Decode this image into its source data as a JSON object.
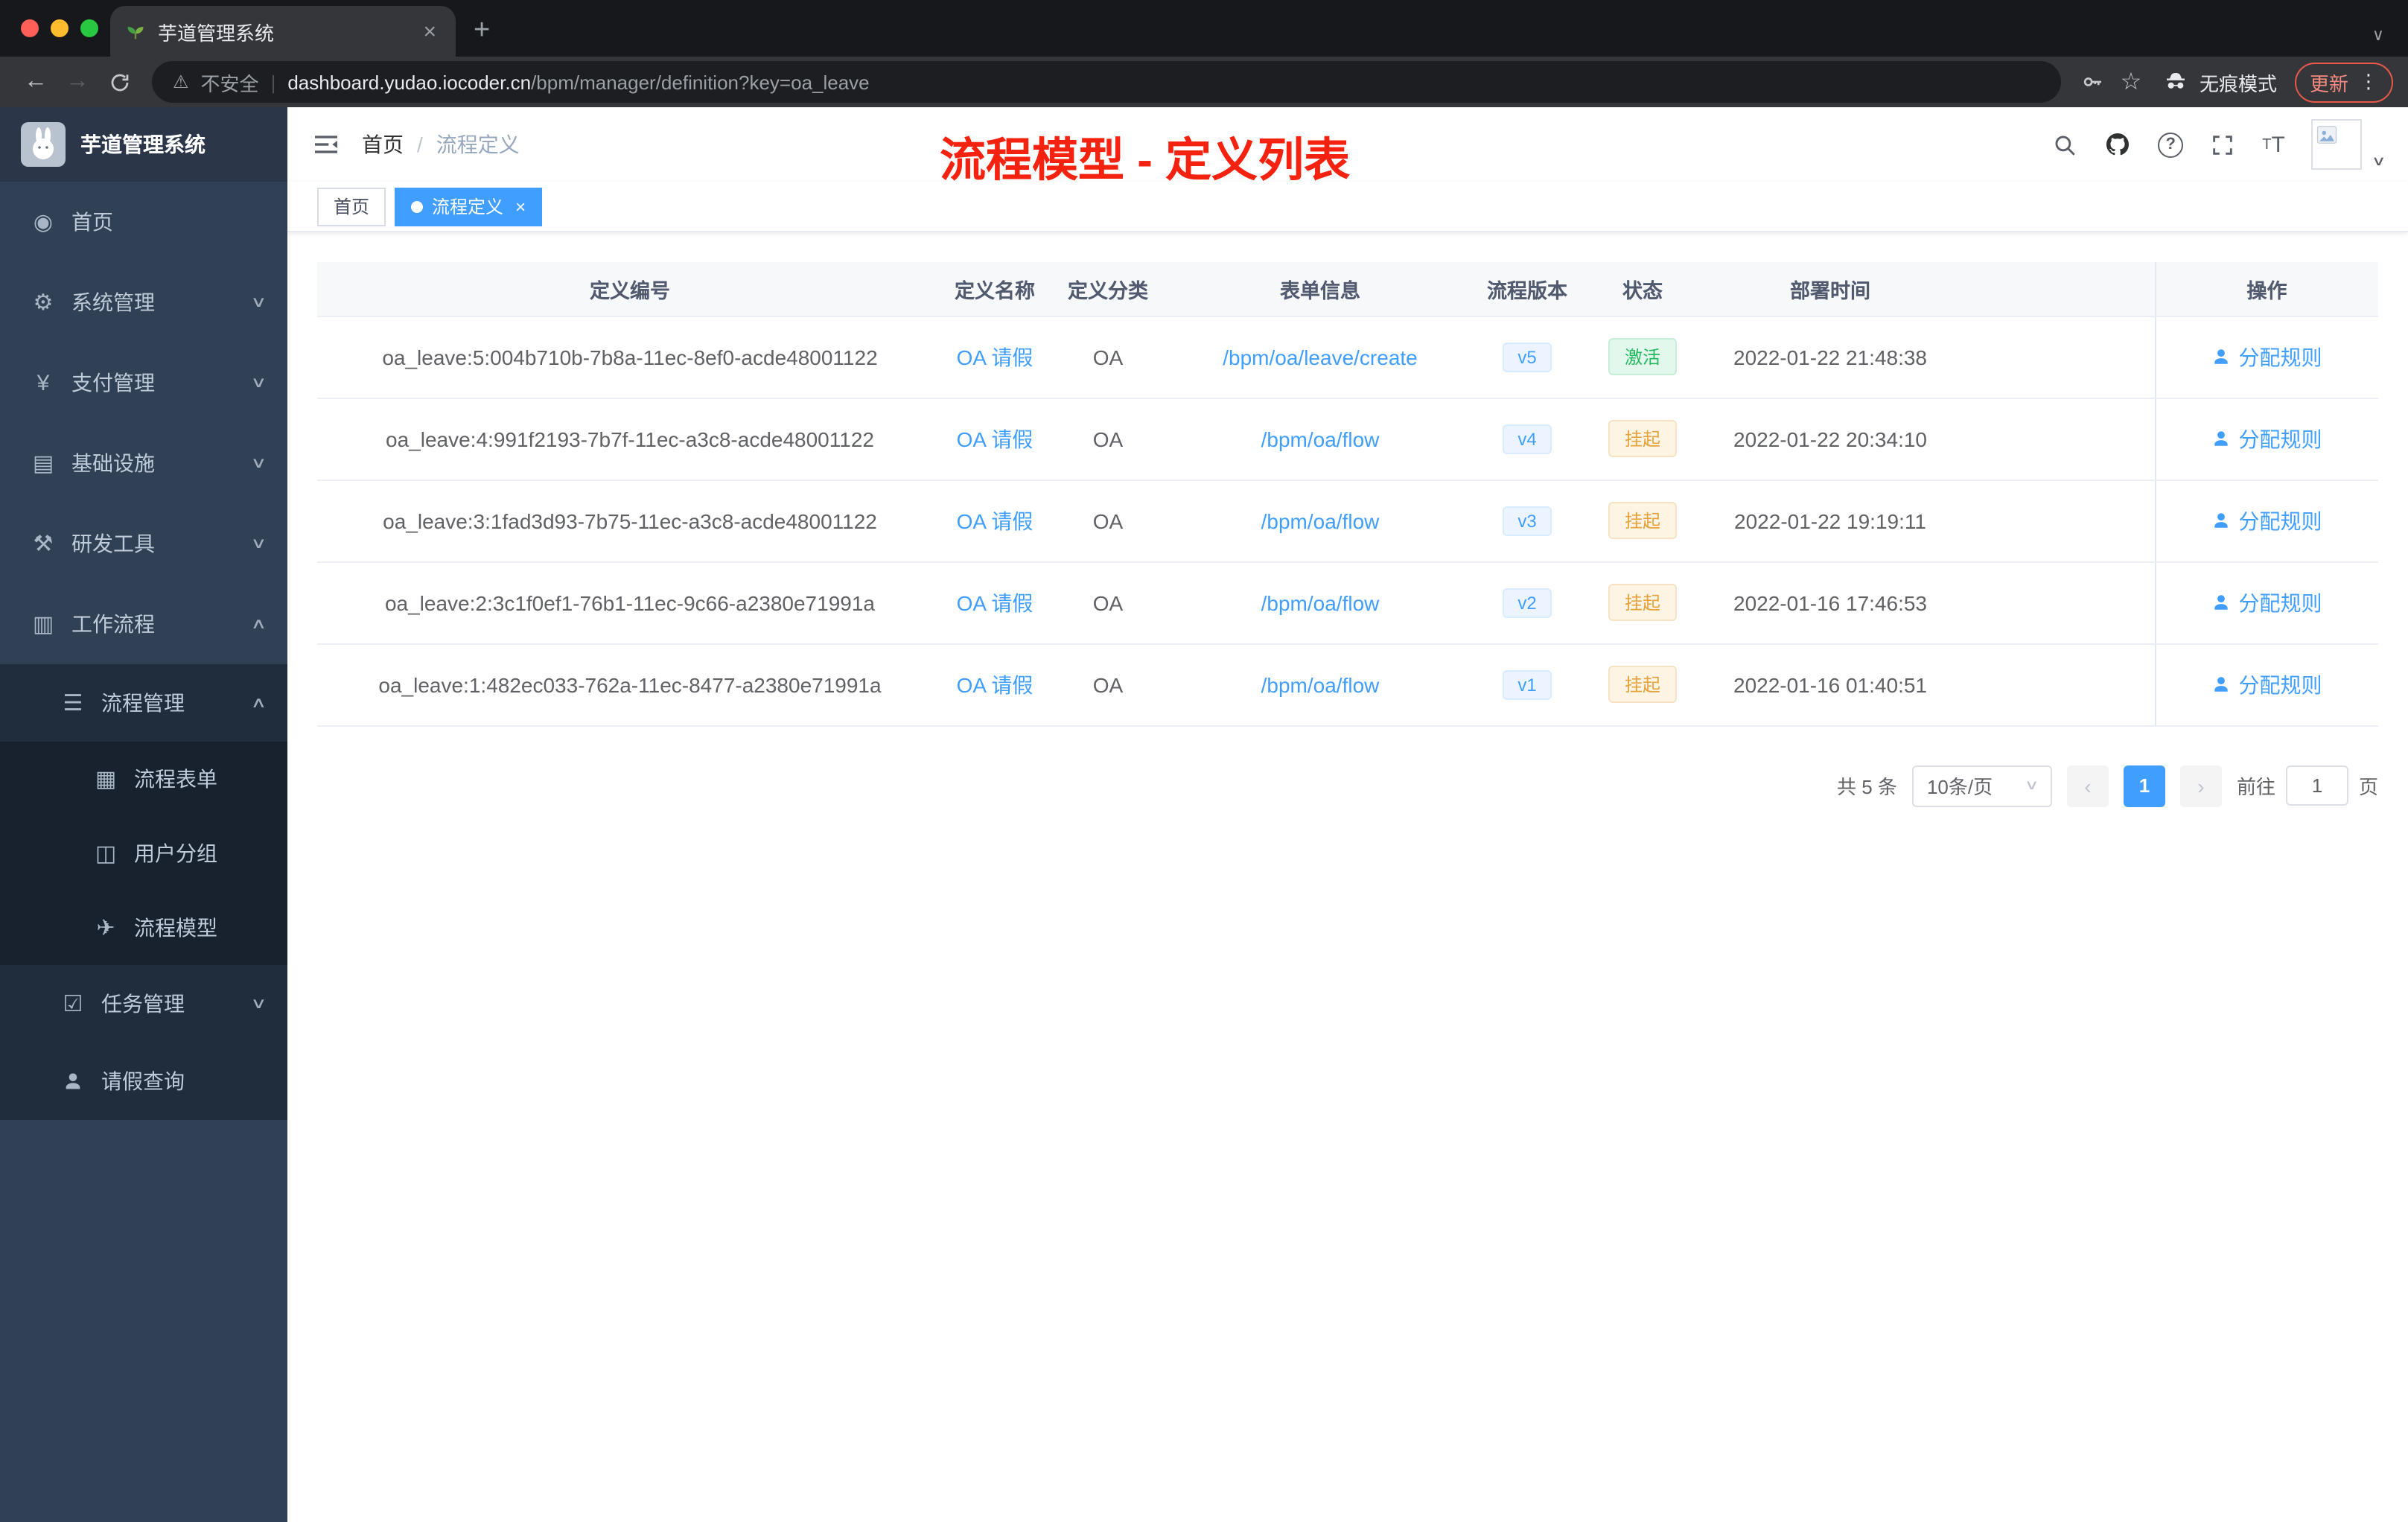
{
  "colors": {
    "primary": "#409eff",
    "success_text": "#23b85e",
    "warning_text": "#e6a23c",
    "annotation_red": "#f4220e",
    "sidebar_bg": "#304156",
    "submenu_bg": "#1f2d3d"
  },
  "browser": {
    "tab_title": "芋道管理系统",
    "security_label": "不安全",
    "url_domain": "dashboard.yudao.iocoder.cn",
    "url_path": "/bpm/manager/definition?key=oa_leave",
    "incognito_label": "无痕模式",
    "update_label": "更新"
  },
  "sidebar": {
    "brand": "芋道管理系统",
    "items": [
      {
        "label": "首页",
        "icon": "dashboard-icon"
      },
      {
        "label": "系统管理",
        "icon": "gear-icon"
      },
      {
        "label": "支付管理",
        "icon": "payment-icon"
      },
      {
        "label": "基础设施",
        "icon": "infrastructure-icon"
      },
      {
        "label": "研发工具",
        "icon": "devtools-icon"
      },
      {
        "label": "工作流程",
        "icon": "workflow-icon"
      },
      {
        "label": "流程管理",
        "icon": "process-management-icon"
      },
      {
        "label": "流程表单",
        "icon": "process-form-icon"
      },
      {
        "label": "用户分组",
        "icon": "user-group-icon"
      },
      {
        "label": "流程模型",
        "icon": "process-model-icon"
      },
      {
        "label": "任务管理",
        "icon": "task-management-icon"
      },
      {
        "label": "请假查询",
        "icon": "leave-query-icon"
      }
    ]
  },
  "header": {
    "breadcrumb": {
      "home": "首页",
      "current": "流程定义"
    },
    "annotation": "流程模型 - 定义列表"
  },
  "tags": {
    "home": "首页",
    "active": "流程定义"
  },
  "table": {
    "columns": [
      "定义编号",
      "定义名称",
      "定义分类",
      "表单信息",
      "流程版本",
      "状态",
      "部署时间",
      "操作"
    ],
    "rows": [
      {
        "id": "oa_leave:5:004b710b-7b8a-11ec-8ef0-acde48001122",
        "name": "OA 请假",
        "category": "OA",
        "form": "/bpm/oa/leave/create",
        "version": "v5",
        "status": "激活",
        "status_class": "cell-tag tag-success",
        "time": "2022-01-22 21:48:38",
        "action": "分配规则"
      },
      {
        "id": "oa_leave:4:991f2193-7b7f-11ec-a3c8-acde48001122",
        "name": "OA 请假",
        "category": "OA",
        "form": "/bpm/oa/flow",
        "version": "v4",
        "status": "挂起",
        "status_class": "cell-tag tag-warning",
        "time": "2022-01-22 20:34:10",
        "action": "分配规则"
      },
      {
        "id": "oa_leave:3:1fad3d93-7b75-11ec-a3c8-acde48001122",
        "name": "OA 请假",
        "category": "OA",
        "form": "/bpm/oa/flow",
        "version": "v3",
        "status": "挂起",
        "status_class": "cell-tag tag-warning",
        "time": "2022-01-22 19:19:11",
        "action": "分配规则"
      },
      {
        "id": "oa_leave:2:3c1f0ef1-76b1-11ec-9c66-a2380e71991a",
        "name": "OA 请假",
        "category": "OA",
        "form": "/bpm/oa/flow",
        "version": "v2",
        "status": "挂起",
        "status_class": "cell-tag tag-warning",
        "time": "2022-01-16 17:46:53",
        "action": "分配规则"
      },
      {
        "id": "oa_leave:1:482ec033-762a-11ec-8477-a2380e71991a",
        "name": "OA 请假",
        "category": "OA",
        "form": "/bpm/oa/flow",
        "version": "v1",
        "status": "挂起",
        "status_class": "cell-tag tag-warning",
        "time": "2022-01-16 01:40:51",
        "action": "分配规则"
      }
    ]
  },
  "pagination": {
    "total_label": "共 5 条",
    "page_size_label": "10条/页",
    "current_page": "1",
    "goto_label": "前往",
    "goto_value": "1",
    "goto_unit_label": "页"
  }
}
